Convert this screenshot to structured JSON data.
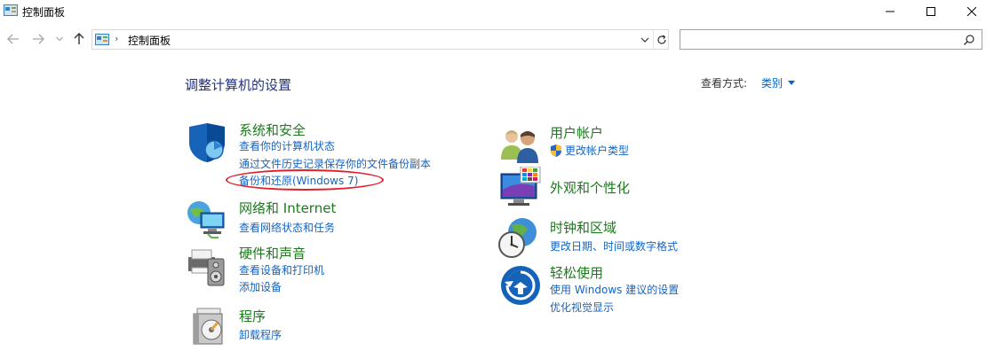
{
  "window": {
    "title": "控制面板"
  },
  "address": {
    "path": "控制面板",
    "separator": "›"
  },
  "search": {
    "value": "",
    "placeholder": ""
  },
  "header": {
    "title": "调整计算机的设置",
    "view_by_label": "查看方式:",
    "view_by_value": "类别"
  },
  "left": [
    {
      "title": "系统和安全",
      "links": [
        "查看你的计算机状态",
        "通过文件历史记录保存你的文件备份副本",
        "备份和还原(Windows 7)"
      ]
    },
    {
      "title": "网络和 Internet",
      "links": [
        "查看网络状态和任务"
      ]
    },
    {
      "title": "硬件和声音",
      "links": [
        "查看设备和打印机",
        "添加设备"
      ]
    },
    {
      "title": "程序",
      "links": [
        "卸载程序"
      ]
    }
  ],
  "right": [
    {
      "title": "用户帐户",
      "links": [
        "更改帐户类型"
      ]
    },
    {
      "title": "外观和个性化",
      "links": []
    },
    {
      "title": "时钟和区域",
      "links": [
        "更改日期、时间或数字格式"
      ]
    },
    {
      "title": "轻松使用",
      "links": [
        "使用 Windows 建议的设置",
        "优化视觉显示"
      ]
    }
  ],
  "colors": {
    "category_title": "#1b7a1b",
    "link": "#1565c0",
    "page_title": "#1e3287",
    "annotation": "#e0202a"
  },
  "icons": [
    "control-panel-icon",
    "back-arrow-icon",
    "forward-arrow-icon",
    "up-arrow-icon",
    "search-icon",
    "refresh-icon",
    "shield-icon",
    "network-icon",
    "printer-icon",
    "programs-icon",
    "users-icon",
    "monitor-palette-icon",
    "clock-globe-icon",
    "ease-of-access-icon",
    "uac-shield-icon"
  ]
}
